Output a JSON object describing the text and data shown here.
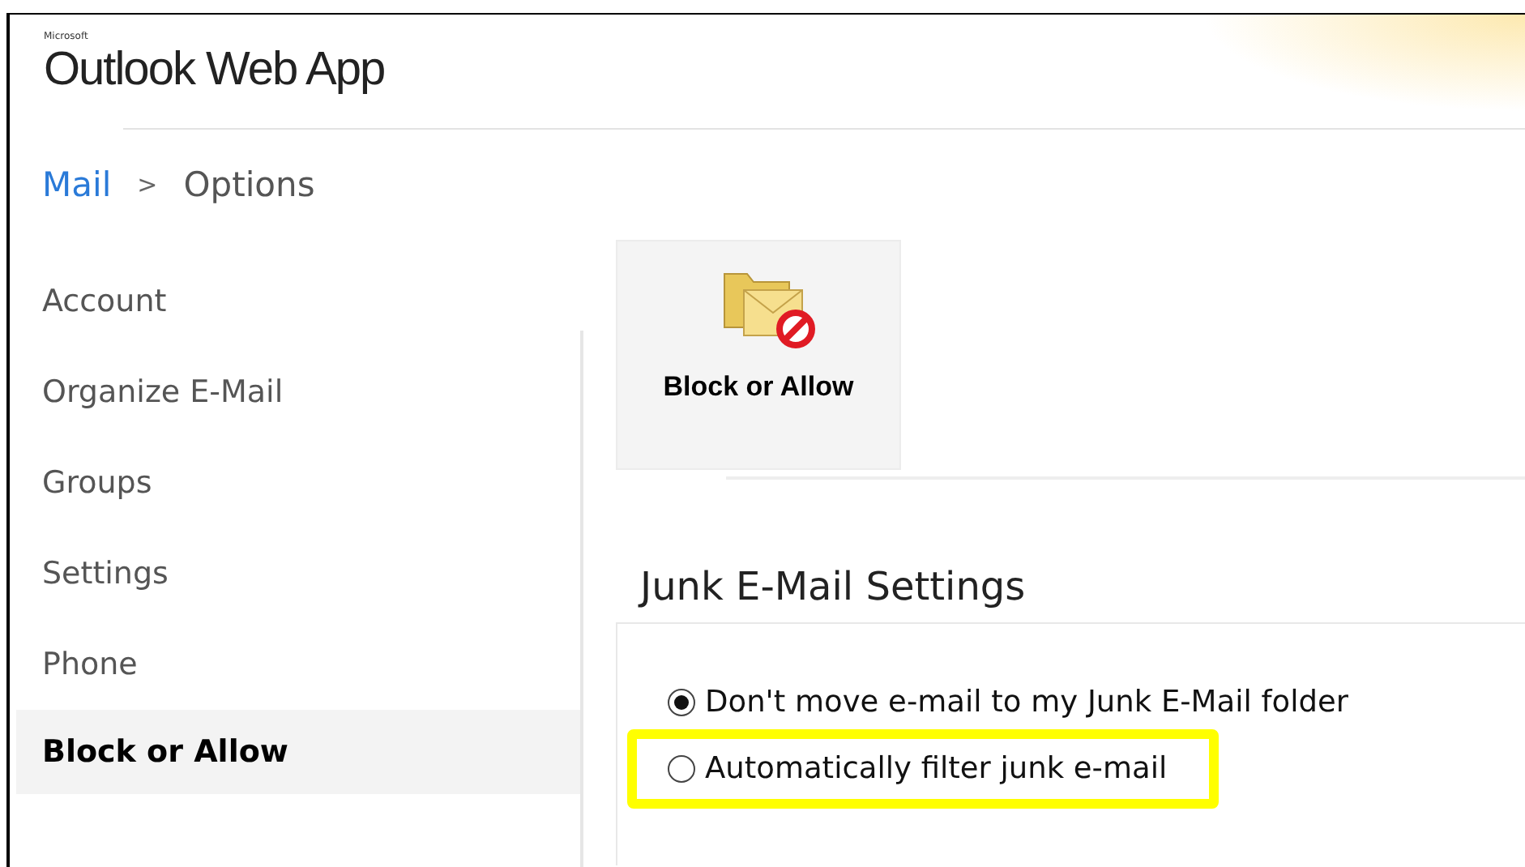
{
  "header": {
    "brand": "Microsoft",
    "title": "Outlook Web App"
  },
  "breadcrumb": [
    {
      "label": "Mail",
      "link": true
    },
    {
      "label": ">",
      "link": false
    },
    {
      "label": "Options",
      "link": false
    }
  ],
  "sidebar": {
    "items": [
      {
        "label": "Account",
        "selected": false
      },
      {
        "label": "Organize E-Mail",
        "selected": false
      },
      {
        "label": "Groups",
        "selected": false
      },
      {
        "label": "Settings",
        "selected": false
      },
      {
        "label": "Phone",
        "selected": false
      },
      {
        "label": "Block or Allow",
        "selected": true
      }
    ]
  },
  "tile": {
    "label": "Block or Allow"
  },
  "section": {
    "title": "Junk E-Mail Settings",
    "options": [
      {
        "label": "Don't move e-mail to my Junk E-Mail folder",
        "selected": true,
        "highlighted": false
      },
      {
        "label": "Automatically filter junk e-mail",
        "selected": false,
        "highlighted": true
      }
    ]
  }
}
